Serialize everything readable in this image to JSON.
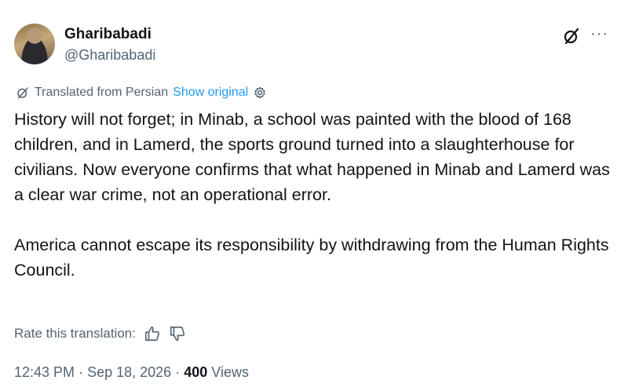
{
  "author": {
    "display_name": "Gharibabadi",
    "handle": "@Gharibabadi"
  },
  "header_icons": [
    "grok-icon",
    "more-icon"
  ],
  "more_label": "···",
  "translation": {
    "label": "Translated from Persian",
    "show_original": "Show original"
  },
  "tweet": {
    "paragraph_1": "History will not forget; in Minab, a school was painted with the blood of 168 children, and in Lamerd, the sports ground turned into a slaughterhouse for civilians. Now everyone confirms that what happened in Minab and Lamerd was a clear war crime, not an operational error.",
    "paragraph_2": "America cannot escape its responsibility by withdrawing from the Human Rights Council."
  },
  "rating": {
    "label": "Rate this translation:"
  },
  "meta": {
    "time": "12:43 PM",
    "separator_1": "·",
    "date": "Sep 18, 2026",
    "separator_2": "·",
    "views_count": "400",
    "views_label": "Views"
  },
  "colors": {
    "text": "#0f1419",
    "secondary": "#536471",
    "link": "#1d9bf0"
  }
}
